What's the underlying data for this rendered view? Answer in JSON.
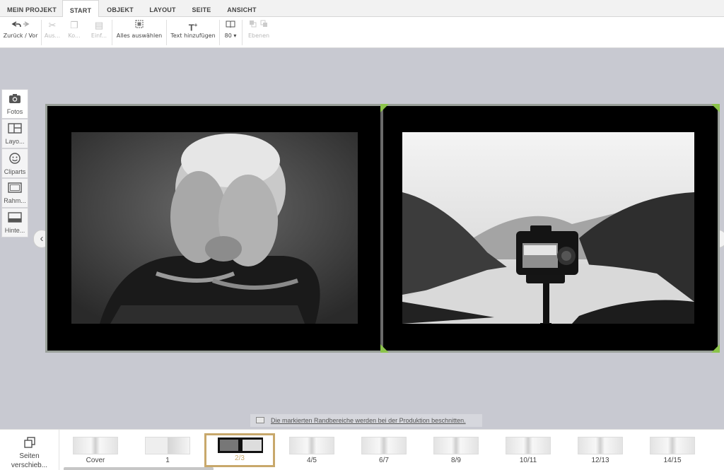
{
  "tabs": [
    {
      "label": "MEIN PROJEKT"
    },
    {
      "label": "START"
    },
    {
      "label": "OBJEKT"
    },
    {
      "label": "LAYOUT"
    },
    {
      "label": "SEITE"
    },
    {
      "label": "ANSICHT"
    }
  ],
  "ribbon": {
    "undo_redo": "Zurück / Vor",
    "cut": "Aus...",
    "copy": "Ko...",
    "paste": "Einf...",
    "select_all": "Alles auswählen",
    "add_text": "Text hinzufügen",
    "zoom": "80",
    "layers": "Ebenen"
  },
  "left_tools": [
    {
      "label": "Fotos"
    },
    {
      "label": "Layo..."
    },
    {
      "label": "Cliparts"
    },
    {
      "label": "Rahm..."
    },
    {
      "label": "Hinte..."
    }
  ],
  "notice": "Die markierten Randbereiche werden bei der Produktion beschnitten.",
  "bottom": {
    "shift_label_1": "Seiten",
    "shift_label_2": "verschieb...",
    "thumbs": [
      {
        "label": "Cover"
      },
      {
        "label": "1"
      },
      {
        "label": "2/3"
      },
      {
        "label": "4/5"
      },
      {
        "label": "6/7"
      },
      {
        "label": "8/9"
      },
      {
        "label": "10/11"
      },
      {
        "label": "12/13"
      },
      {
        "label": "14/15"
      }
    ]
  },
  "colors": {
    "accent": "#c8a86b",
    "canvas": "#c8c9d1",
    "crop_marker": "#8bc34a"
  }
}
